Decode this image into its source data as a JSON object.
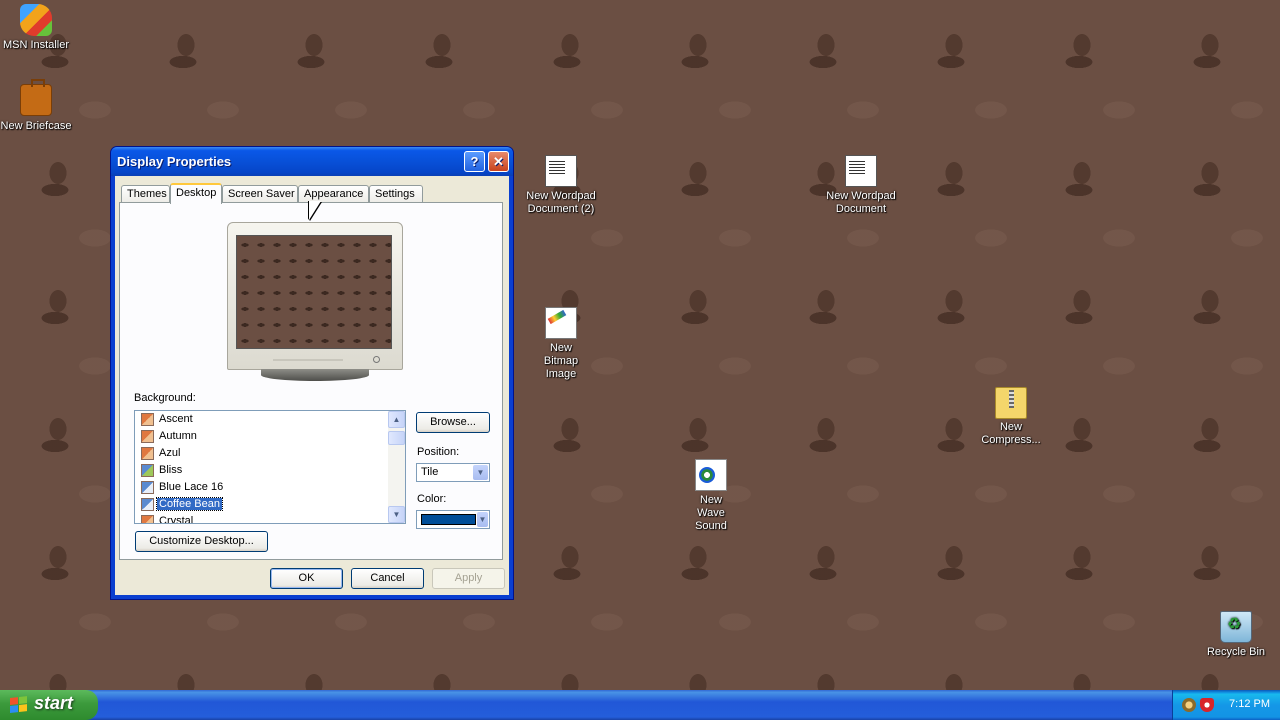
{
  "desktop": {
    "icons": [
      {
        "label": "MSN Installer",
        "icon": "msn-icon"
      },
      {
        "label": "New Briefcase",
        "icon": "briefcase-icon"
      },
      {
        "label": "New Wordpad Document (2)",
        "icon": "wordpad-document-icon"
      },
      {
        "label": "New Wordpad Document",
        "icon": "wordpad-document-icon"
      },
      {
        "label": "New Bitmap Image",
        "icon": "bitmap-image-icon"
      },
      {
        "label": "New Compress...",
        "icon": "compressed-folder-icon"
      },
      {
        "label": "New Wave Sound",
        "icon": "wave-sound-icon"
      },
      {
        "label": "Recycle Bin",
        "icon": "recycle-bin-icon"
      }
    ]
  },
  "dialog": {
    "title": "Display Properties",
    "help_glyph": "?",
    "close_glyph": "✕",
    "tabs": [
      {
        "label": "Themes"
      },
      {
        "label": "Desktop",
        "active": true
      },
      {
        "label": "Screen Saver"
      },
      {
        "label": "Appearance"
      },
      {
        "label": "Settings"
      }
    ],
    "background_label": "Background:",
    "background_items": [
      {
        "label": "Ascent"
      },
      {
        "label": "Autumn"
      },
      {
        "label": "Azul"
      },
      {
        "label": "Bliss"
      },
      {
        "label": "Blue Lace 16"
      },
      {
        "label": "Coffee Bean",
        "selected": true
      },
      {
        "label": "Crystal"
      }
    ],
    "browse_label": "Browse...",
    "position_label": "Position:",
    "position_value": "Tile",
    "color_label": "Color:",
    "color_value": "#004e98",
    "customize_label": "Customize Desktop...",
    "ok_label": "OK",
    "cancel_label": "Cancel",
    "apply_label": "Apply"
  },
  "taskbar": {
    "start_label": "start",
    "clock": "7:12 PM"
  }
}
